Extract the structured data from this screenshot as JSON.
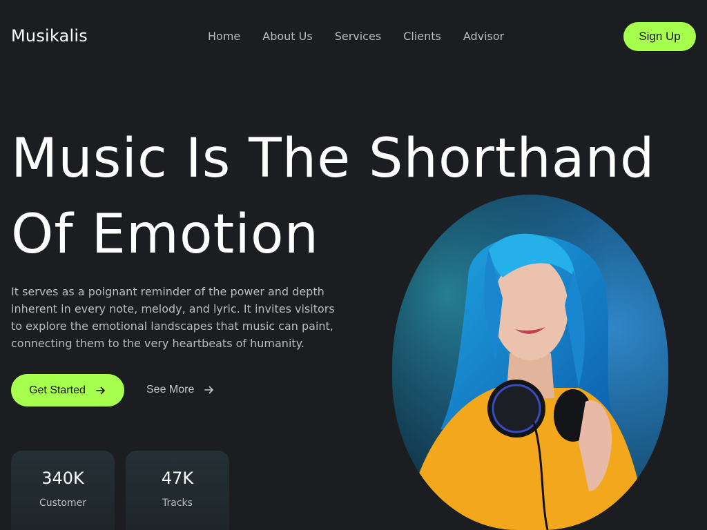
{
  "header": {
    "logo": "Musikalis",
    "nav": [
      "Home",
      "About Us",
      "Services",
      "Clients",
      "Advisor"
    ],
    "signup_label": "Sign Up"
  },
  "hero": {
    "title_line1": "Music Is The Shorthand",
    "title_line2": "Of Emotion",
    "description": "It serves as a poignant reminder of the power and depth inherent in every note, melody, and lyric. It invites visitors to explore the emotional landscapes that music can paint, connecting them to the very heartbeats of humanity.",
    "primary_cta": "Get Started",
    "secondary_cta": "See More"
  },
  "stats": [
    {
      "value": "340K",
      "label": "Customer"
    },
    {
      "value": "47K",
      "label": "Tracks"
    }
  ],
  "colors": {
    "background": "#1b1d21",
    "accent": "#a6ff4d",
    "muted_text": "#b9bcc2"
  },
  "icons": {
    "cta_arrow": "arrow-right-icon"
  }
}
